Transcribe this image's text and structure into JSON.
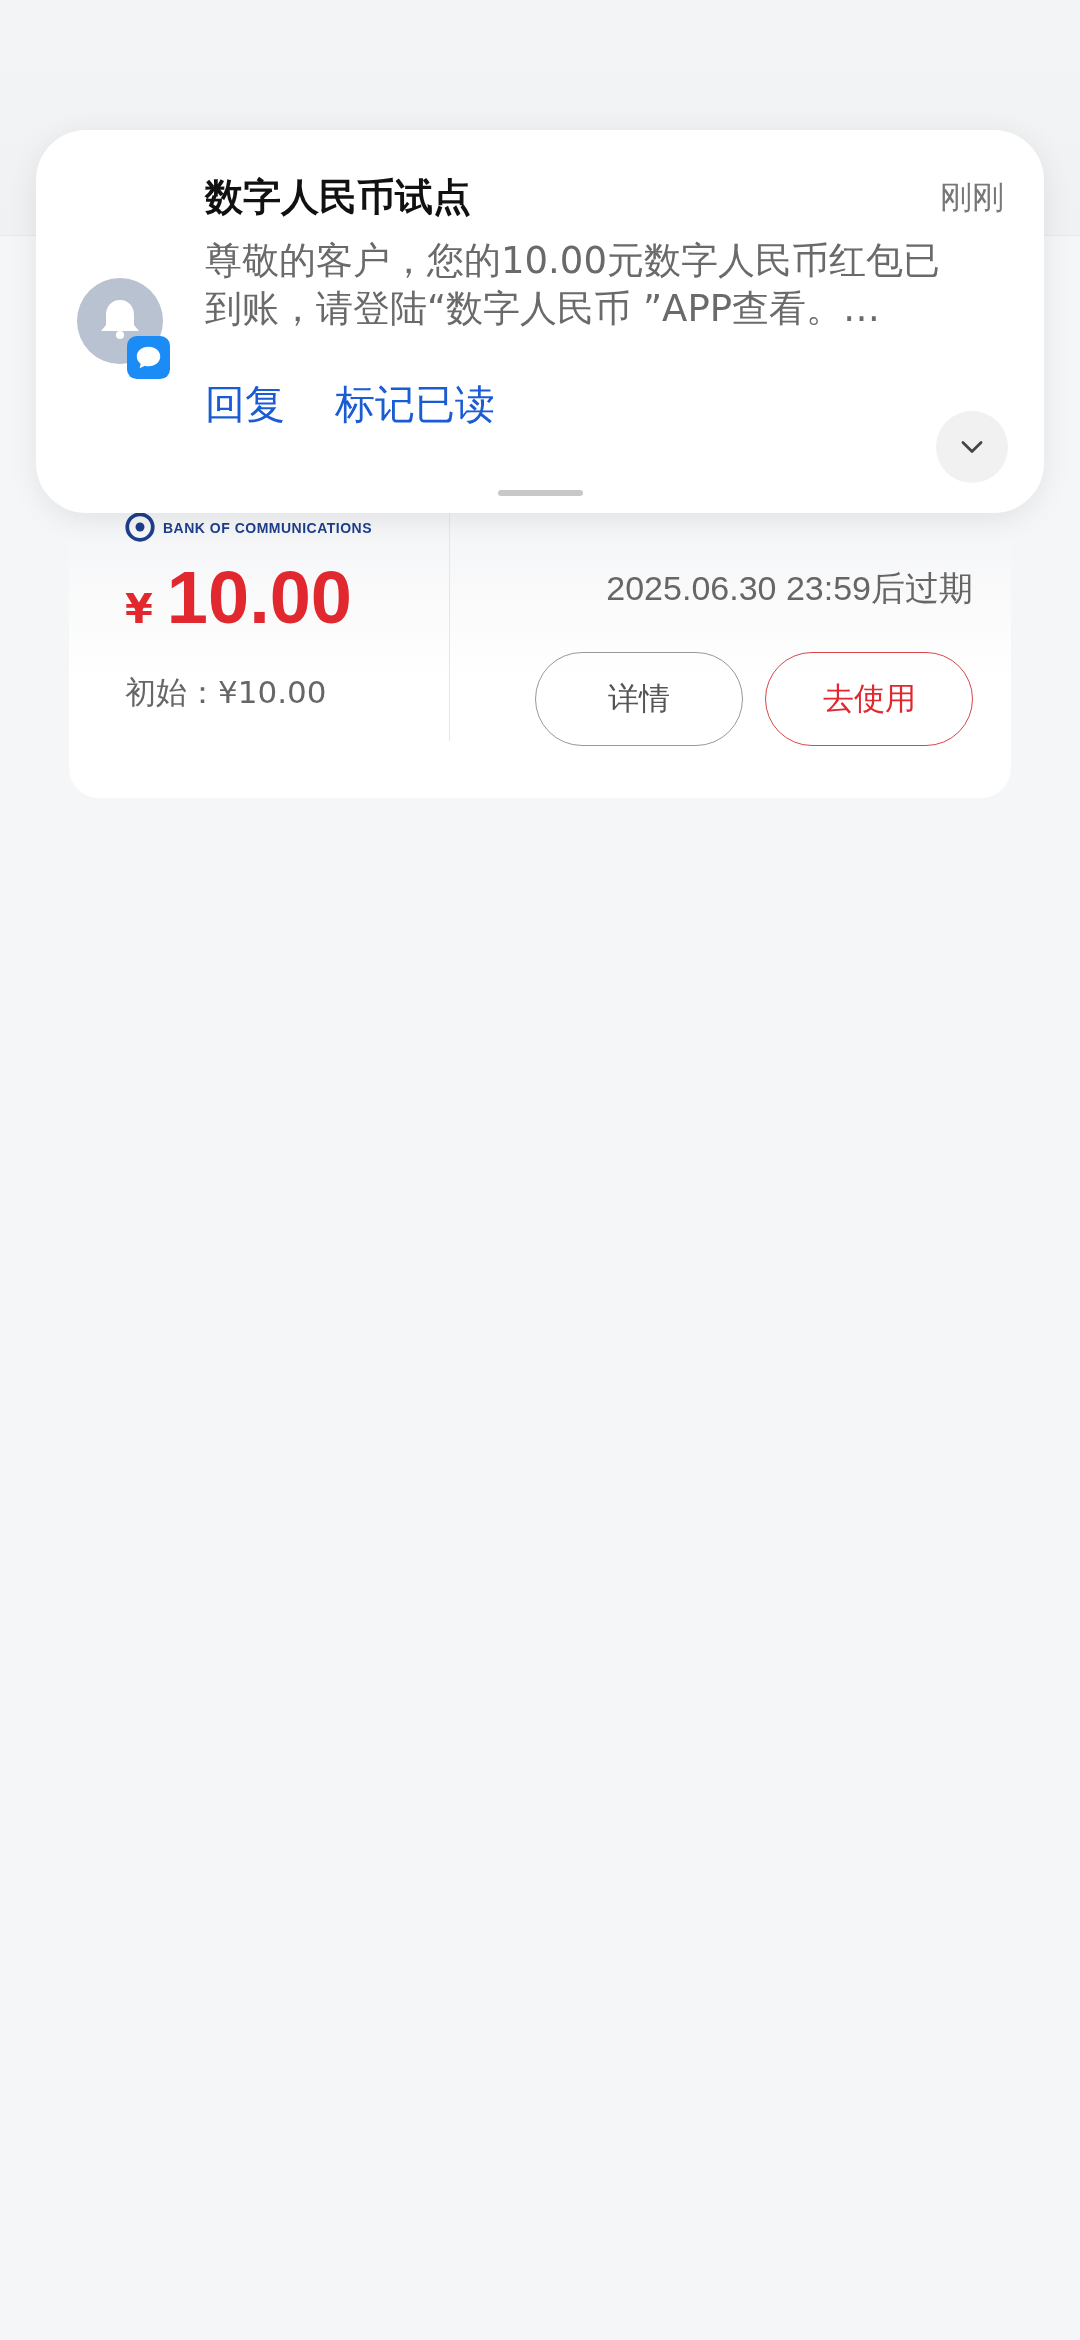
{
  "coupon": {
    "bank_logo_text": "BANK OF COMMUNICATIONS",
    "currency": "¥",
    "amount": "10.00",
    "initial": "初始：¥10.00",
    "expiry": "2025.06.30 23:59后过期",
    "buttons": [
      {
        "label": "详情",
        "kind": "outline"
      },
      {
        "label": "去使用",
        "kind": "primary"
      }
    ]
  },
  "notification": {
    "title": "数字人民币试点",
    "time": "刚刚",
    "body": "尊敬的客户，您的10.00元数字人民币红包已到账，请登陆“数字人民币 ”APP查看。…",
    "actions": [
      {
        "label": "回复"
      },
      {
        "label": "标记已读"
      }
    ]
  }
}
